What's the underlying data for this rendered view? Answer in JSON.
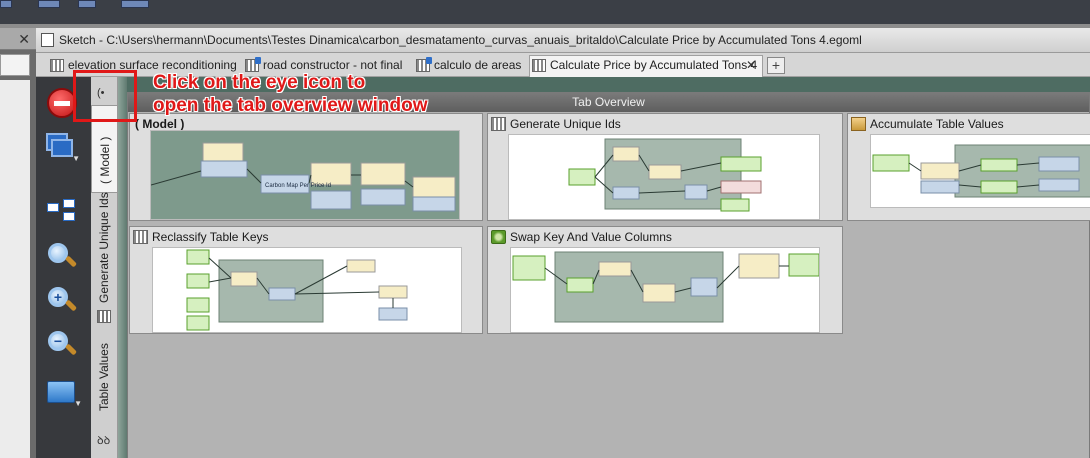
{
  "window": {
    "title": "Sketch - C:\\Users\\hermann\\Documents\\Testes Dinamica\\carbon_desmatamento_curvas_anuais_britaldo\\Calculate Price by Accumulated Tons 4.egoml"
  },
  "tabs": [
    {
      "label": "elevation surface reconditioning"
    },
    {
      "label": "road constructor - not final"
    },
    {
      "label": "calculo de areas"
    },
    {
      "label": "Calculate Price by Accumulated Tons 4"
    }
  ],
  "tab_close": "✕",
  "tab_add": "+",
  "left_dock": {
    "close": "✕"
  },
  "side_tabs": {
    "model": "( Model )",
    "generate": "Generate Unique Ids",
    "table": "Table Values",
    "eye": "(•",
    "tree": "ꝺꝺ"
  },
  "overview": {
    "title": "Tab Overview",
    "cards": [
      {
        "label": "( Model )",
        "icon": "none"
      },
      {
        "label": "Generate Unique Ids",
        "icon": "grid-icon"
      },
      {
        "label": "Accumulate Table Values",
        "icon": "table-icon"
      },
      {
        "label": "Reclassify Table Keys",
        "icon": "grid-icon"
      },
      {
        "label": "Swap Key And Value Columns",
        "icon": "gear-icon"
      }
    ],
    "thumb_texts": [
      "Generate Unique Ids",
      "Carbon Map Per Price Id",
      "Accumulate Table Values",
      "Reclassify Table Keys"
    ]
  },
  "annotation": {
    "line1": "Click on the eye icon to",
    "line2": "open the tab overview window",
    "color": "#e01818"
  },
  "tools": [
    {
      "name": "stop-icon"
    },
    {
      "name": "windows-icon"
    },
    {
      "name": "layout-icon"
    },
    {
      "name": "zoom-fit-icon"
    },
    {
      "name": "zoom-in-icon",
      "symbol": "+"
    },
    {
      "name": "zoom-out-icon",
      "symbol": "−"
    },
    {
      "name": "container-icon"
    }
  ]
}
